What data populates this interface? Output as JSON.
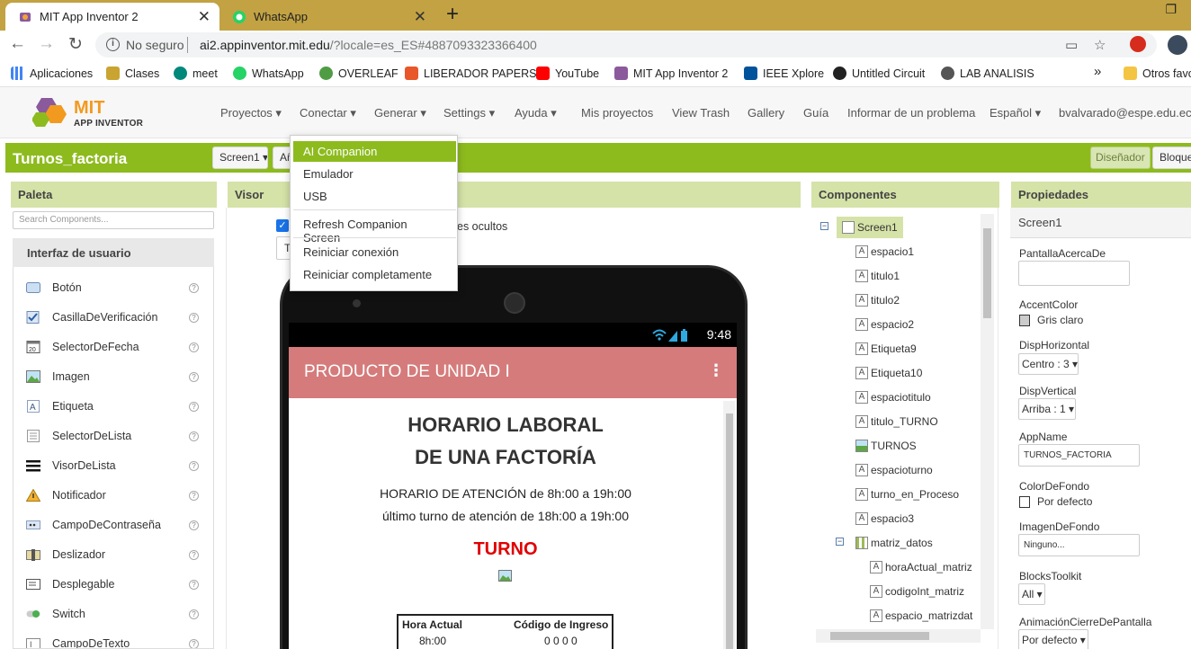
{
  "browser": {
    "tabs": [
      {
        "title": "MIT App Inventor 2",
        "close": "✕"
      },
      {
        "title": "WhatsApp",
        "close": "✕"
      }
    ],
    "new_tab": "+",
    "restore_glyph": "❐",
    "security_label": "No seguro",
    "url_host": "ai2.appinventor.mit.edu",
    "url_path": "/?locale=es_ES#4887093323366400",
    "bookmarks": [
      {
        "label": "Aplicaciones",
        "icon": "apps-grid-icon"
      },
      {
        "label": "Clases",
        "icon": "folder-icon"
      },
      {
        "label": "meet",
        "icon": "meet-icon"
      },
      {
        "label": "WhatsApp",
        "icon": "whatsapp-icon"
      },
      {
        "label": "OVERLEAF",
        "icon": "overleaf-icon"
      },
      {
        "label": "LIBERADOR PAPERS",
        "icon": "liberador-icon"
      },
      {
        "label": "YouTube",
        "icon": "youtube-icon"
      },
      {
        "label": "MIT App Inventor 2",
        "icon": "appinventor-icon"
      },
      {
        "label": "IEEE Xplore",
        "icon": "ieee-icon"
      },
      {
        "label": "Untitled Circuit",
        "icon": "circuit-icon"
      },
      {
        "label": "LAB ANALISIS",
        "icon": "lab-icon"
      }
    ],
    "more_bookmarks": "»",
    "other_bookmarks": "Otros favo"
  },
  "app_header": {
    "logo_top": "MIT",
    "logo_bottom": "APP INVENTOR",
    "menus": [
      "Proyectos",
      "Conectar",
      "Generar",
      "Settings",
      "Ayuda"
    ],
    "links": [
      "Mis proyectos",
      "View Trash",
      "Gallery",
      "Guía",
      "Informar de un problema"
    ],
    "language": "Español",
    "user": "bvalvarado@espe.edu.ec"
  },
  "project_bar": {
    "name": "Turnos_factoria",
    "screen_select": "Screen1",
    "add_screen_partial": "Añ",
    "designer": "Diseñador",
    "blocks": "Bloques"
  },
  "connect_menu": {
    "items": [
      "AI Companion",
      "Emulador",
      "USB",
      "Refresh Companion Screen",
      "Reiniciar conexión",
      "Reiniciar completamente"
    ],
    "selected": "AI Companion"
  },
  "palette": {
    "title": "Paleta",
    "search_placeholder": "Search Components...",
    "group": "Interfaz de usuario",
    "items": [
      {
        "label": "Botón",
        "icon": "button-icon"
      },
      {
        "label": "CasillaDeVerificación",
        "icon": "checkbox-icon"
      },
      {
        "label": "SelectorDeFecha",
        "icon": "calendar-icon"
      },
      {
        "label": "Imagen",
        "icon": "image-icon"
      },
      {
        "label": "Etiqueta",
        "icon": "label-icon"
      },
      {
        "label": "SelectorDeLista",
        "icon": "listpicker-icon"
      },
      {
        "label": "VisorDeLista",
        "icon": "listview-icon"
      },
      {
        "label": "Notificador",
        "icon": "warning-icon"
      },
      {
        "label": "CampoDeContraseña",
        "icon": "password-icon"
      },
      {
        "label": "Deslizador",
        "icon": "slider-icon"
      },
      {
        "label": "Desplegable",
        "icon": "spinner-icon"
      },
      {
        "label": "Switch",
        "icon": "switch-icon"
      },
      {
        "label": "CampoDeTexto",
        "icon": "textbox-icon"
      }
    ],
    "help_glyph": "?"
  },
  "visor": {
    "title": "Visor",
    "hidden_label_partial": "es ocultos",
    "checkbox_checked": true,
    "size_select_partial": "T",
    "phone": {
      "time": "9:48",
      "app_title": "PRODUCTO DE UNIDAD I",
      "heading_line1": "HORARIO LABORAL",
      "heading_line2": "DE UNA FACTORÍA",
      "line1": "HORARIO DE ATENCIÓN de 8h:00 a 19h:00",
      "line2": "último turno de atención de 18h:00 a 19h:00",
      "turno": "TURNO",
      "table": {
        "headers": [
          "Hora Actual",
          "Código de Ingreso"
        ],
        "row": [
          "8h:00",
          "0 0 0 0"
        ]
      }
    }
  },
  "components": {
    "title": "Componentes",
    "root": "Screen1",
    "items": [
      {
        "label": "espacio1",
        "kind": "label"
      },
      {
        "label": "titulo1",
        "kind": "label"
      },
      {
        "label": "titulo2",
        "kind": "label"
      },
      {
        "label": "espacio2",
        "kind": "label"
      },
      {
        "label": "Etiqueta9",
        "kind": "label"
      },
      {
        "label": "Etiqueta10",
        "kind": "label"
      },
      {
        "label": "espaciotitulo",
        "kind": "label"
      },
      {
        "label": "titulo_TURNO",
        "kind": "label"
      },
      {
        "label": "TURNOS",
        "kind": "image"
      },
      {
        "label": "espacioturno",
        "kind": "label"
      },
      {
        "label": "turno_en_Proceso",
        "kind": "label"
      },
      {
        "label": "espacio3",
        "kind": "label"
      },
      {
        "label": "matriz_datos",
        "kind": "table"
      }
    ],
    "children": [
      {
        "label": "horaActual_matriz"
      },
      {
        "label": "codigoInt_matriz"
      },
      {
        "label": "espacio_matrizdat"
      }
    ]
  },
  "properties": {
    "title": "Propiedades",
    "component": "Screen1",
    "fields": {
      "pantalla_acerca_de": {
        "label": "PantallaAcercaDe",
        "value": ""
      },
      "accent_color": {
        "label": "AccentColor",
        "value": "Gris claro",
        "swatch": "#cccccc"
      },
      "disp_horizontal": {
        "label": "DispHorizontal",
        "value": "Centro : 3"
      },
      "disp_vertical": {
        "label": "DispVertical",
        "value": "Arriba : 1"
      },
      "app_name": {
        "label": "AppName",
        "value": "TURNOS_FACTORIA"
      },
      "color_de_fondo": {
        "label": "ColorDeFondo",
        "value": "Por defecto",
        "swatch": "#ffffff"
      },
      "imagen_de_fondo": {
        "label": "ImagenDeFondo",
        "value": "Ninguno..."
      },
      "blocks_toolkit": {
        "label": "BlocksToolkit",
        "value": "All"
      },
      "animacion_cierre": {
        "label": "AnimaciónCierreDePantalla",
        "value": "Por defecto"
      }
    }
  },
  "colors": {
    "accent_green": "#8dbb1e",
    "panel_header": "#d5e3a8",
    "phone_appbar": "#d57b7b",
    "turno_red": "#e00000",
    "chrome_tabstrip": "#c2a243"
  }
}
